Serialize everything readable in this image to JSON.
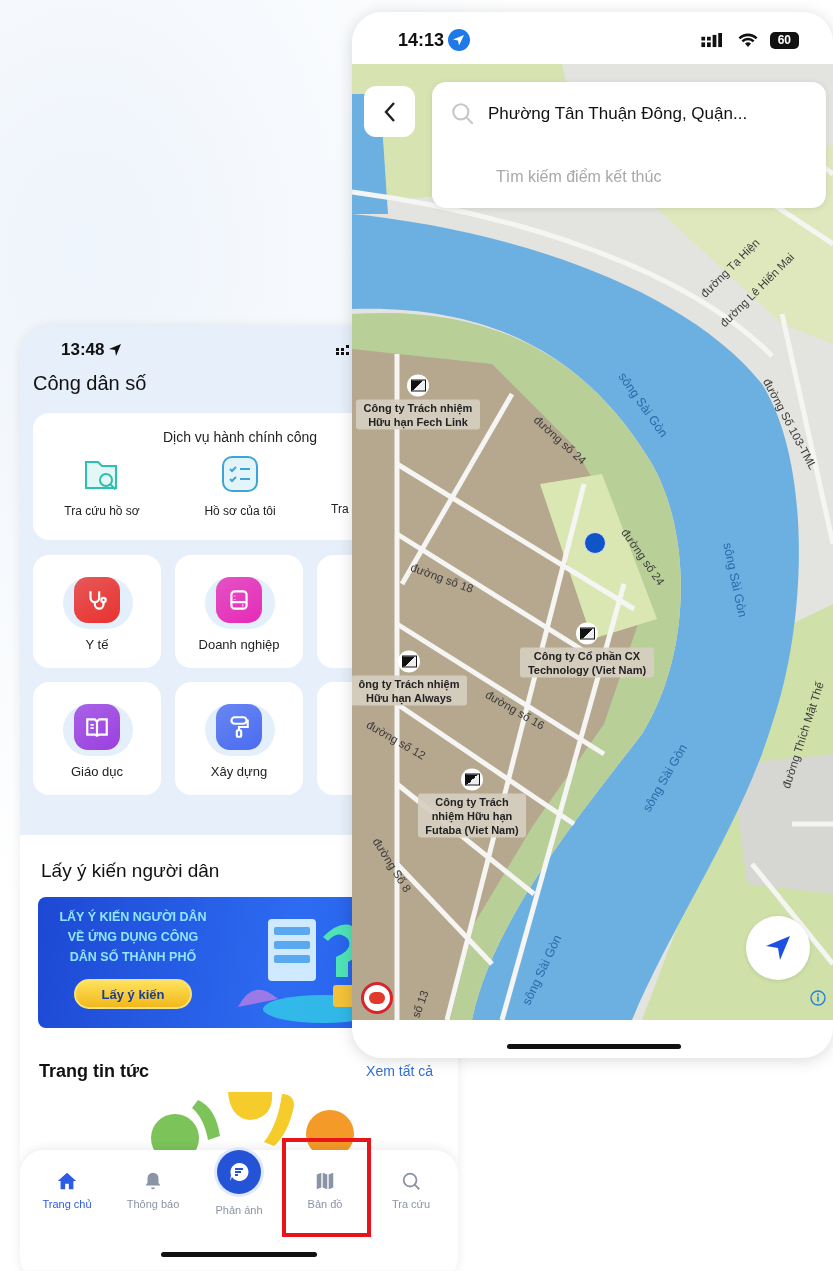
{
  "left_phone": {
    "status_bar": {
      "time": "13:48"
    },
    "title": "Công dân số",
    "services": {
      "heading": "Dịch vụ hành chính công",
      "items": [
        {
          "label": "Tra cứu hồ sơ",
          "kind": "item"
        },
        {
          "label": "Hồ sơ của tôi",
          "kind": "item"
        },
        {
          "label": "Tra",
          "kind": "partial"
        }
      ]
    },
    "categories": [
      [
        {
          "kind": "card",
          "label": "Y tế",
          "color": "#e8322f"
        },
        {
          "kind": "card",
          "label": "Doanh nghiệp",
          "color": "#e52bb7"
        },
        {
          "kind": "partial"
        }
      ],
      [
        {
          "kind": "card",
          "label": "Giáo dục",
          "color": "#9b3fe0"
        },
        {
          "kind": "card",
          "label": "Xây dựng",
          "color": "#4a6cf0"
        },
        {
          "kind": "partial"
        }
      ]
    ],
    "opinion": {
      "heading": "Lấy ý kiến người dân",
      "banner": {
        "lines": [
          "LẤY Ý KIẾN NGƯỜI DÂN",
          "VỀ ỨNG DỤNG CÔNG",
          "DÂN SỐ THÀNH PHỐ"
        ],
        "button": "Lấy ý kiến"
      }
    },
    "news": {
      "heading": "Trang tin tức",
      "link": "Xem tất cả"
    },
    "tabs": [
      {
        "label": "Trang chủ",
        "kind": "normal",
        "selected": true,
        "highlighted": false
      },
      {
        "label": "Thông báo",
        "kind": "normal",
        "selected": false,
        "highlighted": false
      },
      {
        "label": "Phản ánh",
        "kind": "raised",
        "selected": false,
        "highlighted": false
      },
      {
        "label": "Bản đồ",
        "kind": "normal",
        "selected": false,
        "highlighted": true
      },
      {
        "label": "Tra cứu",
        "kind": "normal",
        "selected": false,
        "highlighted": false
      }
    ]
  },
  "right_phone": {
    "status_bar": {
      "time": "14:13",
      "battery": "60"
    },
    "search": {
      "value": "Phường Tân Thuận Đông, Quận...",
      "placeholder": "Tìm kiếm điểm kết thúc"
    },
    "map": {
      "labels": [
        {
          "text": "đường Tạ Hiện",
          "kind": "street"
        },
        {
          "text": "đường Lê Hiến Mai",
          "kind": "street"
        },
        {
          "text": "sông Sài Gòn",
          "kind": "river"
        },
        {
          "text": "đường Số 103-TML",
          "kind": "street"
        },
        {
          "text": "Công ty Trách nhiệm Hữu hạn Fech Link",
          "kind": "place"
        },
        {
          "text": "đường số 24",
          "kind": "street"
        },
        {
          "text": "đường số 24",
          "kind": "street"
        },
        {
          "text": "sông Sài Gòn",
          "kind": "river"
        },
        {
          "text": "đường số 18",
          "kind": "street"
        },
        {
          "text": "Công ty Cổ phần CX Technology (Viet Nam)",
          "kind": "place"
        },
        {
          "text": "ông ty Trách nhiệm Hữu hạn Always",
          "kind": "place"
        },
        {
          "text": "đường số 16",
          "kind": "street"
        },
        {
          "text": "đường số 12",
          "kind": "street"
        },
        {
          "text": "Công ty Trách nhiệm Hữu hạn Futaba (Viet Nam)",
          "kind": "place"
        },
        {
          "text": "sông Sài Gòn",
          "kind": "river"
        },
        {
          "text": "đường Thích Mật Thế",
          "kind": "street"
        },
        {
          "text": "đường Số 8",
          "kind": "street"
        },
        {
          "text": "sông Sài Gòn",
          "kind": "river"
        },
        {
          "text": "số 13",
          "kind": "street"
        }
      ]
    }
  }
}
